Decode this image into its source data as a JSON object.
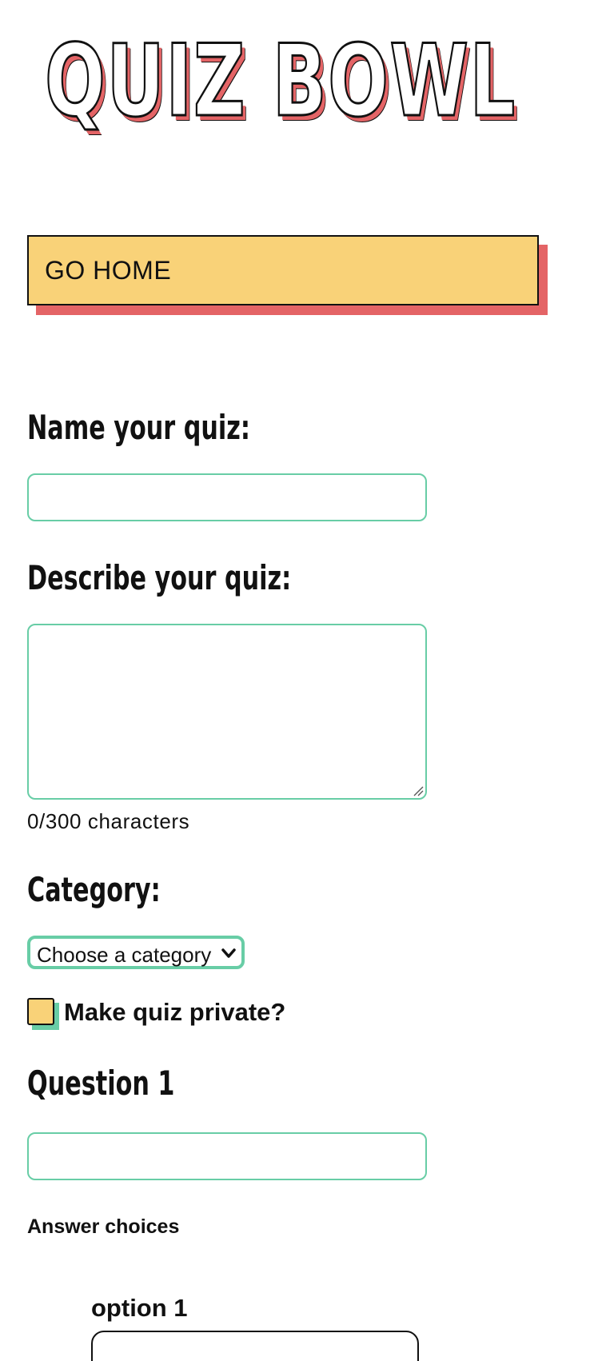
{
  "app": {
    "logo_text": "QUIZ BOWL"
  },
  "nav": {
    "home_label": "GO HOME"
  },
  "form": {
    "name_label": "Name your quiz:",
    "name_value": "",
    "description_label": "Describe your quiz:",
    "description_value": "",
    "char_count": "0/300 characters",
    "category_label": "Category:",
    "category_selected": "Choose a category",
    "private_label": "Make quiz private?",
    "private_checked": false,
    "question_title": "Question 1",
    "question_value": "",
    "answer_choices_label": "Answer choices",
    "options": [
      {
        "label": "option 1",
        "value": ""
      }
    ]
  },
  "colors": {
    "accent_yellow": "#f9d278",
    "accent_red": "#e46466",
    "accent_green": "#68cda6",
    "ink": "#111111"
  }
}
